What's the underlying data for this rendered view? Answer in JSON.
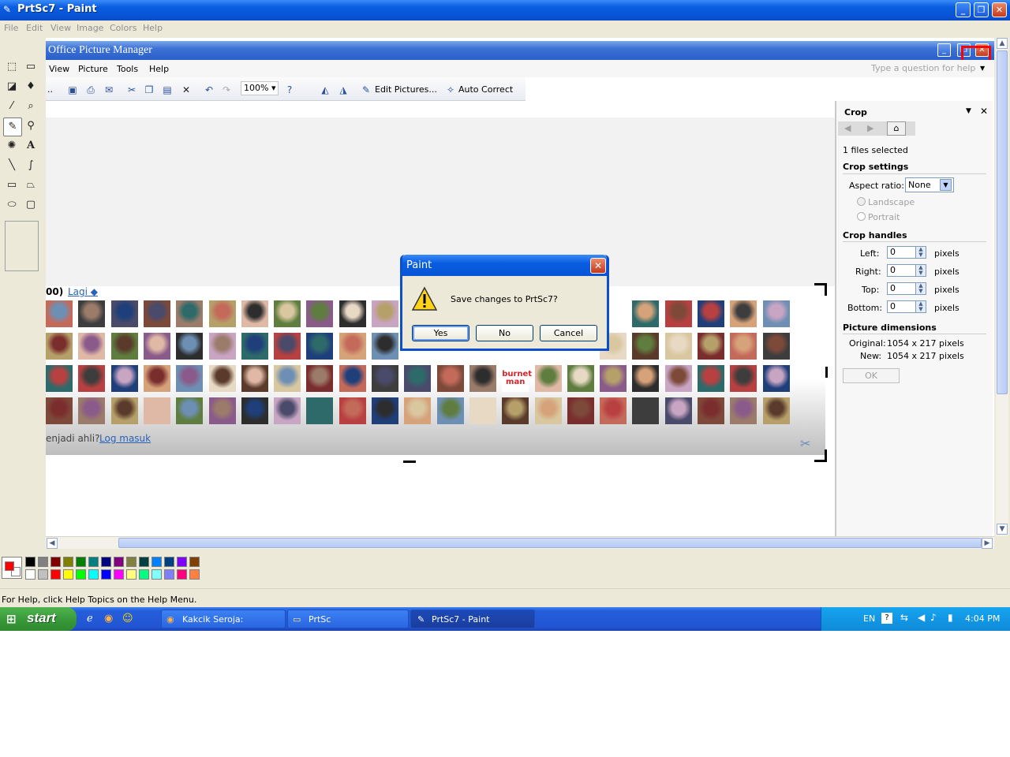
{
  "paint": {
    "title": "PrtSc7 - Paint",
    "menu": [
      "File",
      "Edit",
      "View",
      "Image",
      "Colors",
      "Help"
    ],
    "status_text": "For Help, click Help Topics on the Help Menu."
  },
  "picture_manager": {
    "title": "Office Picture Manager",
    "menu": [
      "View",
      "Picture",
      "Tools",
      "Help"
    ],
    "help_placeholder": "Type a question for help",
    "toolbar": {
      "leading": "..",
      "zoom": "100%",
      "edit_pictures": "Edit Pictures...",
      "auto_correct": "Auto Correct"
    },
    "web": {
      "header_count": "00)",
      "more_link": "Lagi ◆",
      "footer_text": "enjadi ahli?",
      "login_link": "Log masuk",
      "thumb_text": "burnet man"
    },
    "task_pane": {
      "title": "Crop",
      "files_selected": "1 files selected",
      "crop_settings": "Crop settings",
      "aspect_label": "Aspect ratio:",
      "aspect_value": "None",
      "landscape": "Landscape",
      "portrait": "Portrait",
      "crop_handles": "Crop handles",
      "handles": [
        {
          "label": "Left:",
          "value": "0",
          "unit": "pixels"
        },
        {
          "label": "Right:",
          "value": "0",
          "unit": "pixels"
        },
        {
          "label": "Top:",
          "value": "0",
          "unit": "pixels"
        },
        {
          "label": "Bottom:",
          "value": "0",
          "unit": "pixels"
        }
      ],
      "dimensions_title": "Picture dimensions",
      "original_label": "Original:",
      "original_value": "1054 x 217 pixels",
      "new_label": "New:",
      "new_value": "1054 x 217 pixels",
      "ok_label": "OK"
    }
  },
  "dialog": {
    "title": "Paint",
    "message": "Save changes to PrtSc7?",
    "yes": "Yes",
    "no": "No",
    "cancel": "Cancel"
  },
  "taskbar": {
    "start": "start",
    "tasks": [
      "Kakcik Seroja: Klasik.....",
      "PrtSc",
      "PrtSc7 - Paint"
    ],
    "lang": "EN",
    "clock": "4:04 PM"
  },
  "colors": {
    "xp_blue": "#0a5de0",
    "highlight_box": "#ff0000",
    "palette": [
      "#000000",
      "#808080",
      "#800000",
      "#808000",
      "#008000",
      "#008080",
      "#000080",
      "#800080",
      "#808040",
      "#004040",
      "#0080ff",
      "#004080",
      "#8000ff",
      "#804000",
      "#ffffff",
      "#c0c0c0",
      "#ff0000",
      "#ffff00",
      "#00ff00",
      "#00ffff",
      "#0000ff",
      "#ff00ff",
      "#ffff80",
      "#00ff80",
      "#80ffff",
      "#8080ff",
      "#ff0080",
      "#ff8040"
    ]
  }
}
